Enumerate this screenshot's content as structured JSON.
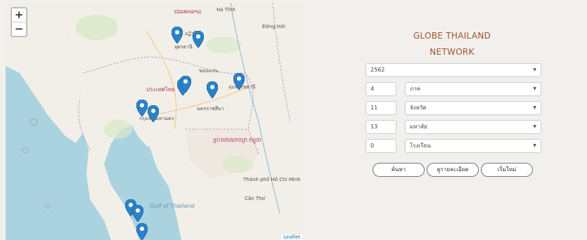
{
  "map": {
    "zoom_in": "+",
    "zoom_out": "−",
    "attribution": "Leaflet",
    "labels": {
      "laos": "ປະເທດລາວ",
      "thailand": "ประเทศไทย",
      "bangkok": "กรุงเทพมหานคร",
      "cambodia": "ព្រះរាជាណាចក្រ កម្ពុជា",
      "hcmc": "Thành phố Hồ Chí Minh",
      "can_tho": "Cần Thơ",
      "gulf": "Gulf of Thailand",
      "vientiane": "ວຽງຈັນ",
      "ha_tinh": "Hà Tĩnh",
      "dong_hoi": "Đồng Hới",
      "udon": "อุดรธานี",
      "khon_kaen": "ขอนแก่น",
      "korat": "นครราชสีมา",
      "ubon": "อุบลราชธานี"
    }
  },
  "panel": {
    "title_line1": "GLOBE THAILAND",
    "title_line2": "NETWORK",
    "year": {
      "value": "2562"
    },
    "rows": [
      {
        "count": "4",
        "label": "ภาค"
      },
      {
        "count": "11",
        "label": "จังหวัด"
      },
      {
        "count": "13",
        "label": "มหาลัย"
      },
      {
        "count": "0",
        "label": "โรงเรียน"
      }
    ],
    "buttons": {
      "search": "ค้นหา",
      "details": "ดูรายละเอียด",
      "reset": "เริ่มใหม่"
    }
  }
}
